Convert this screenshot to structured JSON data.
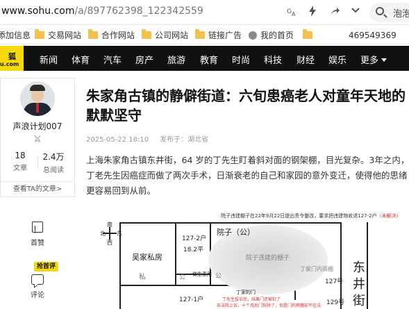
{
  "browser": {
    "url_host": "www.sohu.com",
    "url_path": "/a/897762398_122342559",
    "search_text": "泡泡",
    "toolbar_icons": [
      "translate-icon",
      "bolt-icon",
      "share-icon",
      "chevron-down-icon"
    ]
  },
  "bookmarks": {
    "items": [
      {
        "label": "添加信息",
        "icon": "none"
      },
      {
        "label": "交易网站",
        "icon": "folder-icon"
      },
      {
        "label": "合作网站",
        "icon": "folder-icon"
      },
      {
        "label": "公司网站",
        "icon": "folder-icon"
      },
      {
        "label": "链接广告",
        "icon": "folder-icon"
      },
      {
        "label": "我的首页",
        "icon": "globe-icon"
      },
      {
        "label": "",
        "icon": "folder-icon"
      },
      {
        "label": "469549369",
        "icon": "none"
      }
    ]
  },
  "site_nav": {
    "logo_text": "狐",
    "logo_sub": "u.com",
    "links": [
      "新闻",
      "体育",
      "汽车",
      "房产",
      "旅游",
      "教育",
      "时尚",
      "科技",
      "财经",
      "娱乐",
      "更多"
    ],
    "accent": "#f5d90a"
  },
  "author": {
    "name": "声浪计划007",
    "articles_count": "18",
    "articles_label": "文章",
    "reads_count": "2.4万",
    "reads_label": "总阅读",
    "more_label": "查看TA的文章>"
  },
  "actions": {
    "like_label": "首赞",
    "comment_tag": "抢首评",
    "comment_label": "评论"
  },
  "article": {
    "title": "朱家角古镇的静僻街道：六旬患癌老人对童年天地的默默坚守",
    "date": "2025-05-22 18:10",
    "source": "发布于：湖北省",
    "body": "上海朱家角古镇东井街，64 岁的丁先生盯着斜对面的钢架棚，目光复杂。3年之内，丁老先生因癌症而做了两次手术，日渐衰老的自己和家园的意外变迁，使得他的思绪更容易回到从前。"
  },
  "figure": {
    "caption": "院子违建棚子在22年9月22日提出责令整改，要求把违建物收退127-2户",
    "caption_red": "（未解决）",
    "compass": {
      "n": "南",
      "s": "北",
      "e": "东",
      "w": "西"
    },
    "labels": {
      "wu_house": "吴家私房",
      "si": "私",
      "unit_127_2": "127-2户",
      "area": "18.2平",
      "gong1": "公",
      "gong2": "公",
      "courtyard": "院子（公）",
      "shed": "院子违建的棚子",
      "workshop": "做生意用",
      "rain_shelter": "丁家门内雨棚",
      "unit_127": "127号",
      "unit_129": "129号",
      "unit_127_1": "127-1户",
      "ding_door": "丁家的门",
      "note": "丁先生投诉后，结果门还被封了",
      "note2": "去法院上诉，十个月后门拆除了，但是门的雨棚却不往法",
      "street": "东井街"
    }
  }
}
